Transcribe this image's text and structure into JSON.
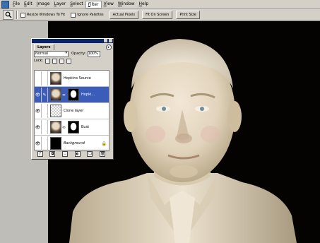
{
  "menubar": {
    "items": [
      "File",
      "Edit",
      "Image",
      "Layer",
      "Select",
      "Filter",
      "View",
      "Window",
      "Help"
    ],
    "active_index": 5
  },
  "options_bar": {
    "tool_icon": "zoom-icon",
    "resize_windows": "Resize Windows To Fit",
    "ignore_palettes": "Ignore Palettes",
    "actual_pixels": "Actual Pixels",
    "fit_on_screen": "Fit On Screen",
    "print_size": "Print Size"
  },
  "layers_palette": {
    "tab": "Layers",
    "menu_arrow": "▸",
    "blend_mode": "Normal",
    "opacity_label": "Opacity:",
    "opacity_value": "100%",
    "lock_label": "Lock:",
    "layers": [
      {
        "name": "Hopkins Source",
        "visible": false,
        "selected": false,
        "thumb": "face"
      },
      {
        "name": "Hopki...",
        "visible": true,
        "selected": true,
        "thumb": "face",
        "mask": true
      },
      {
        "name": "Clone layer",
        "visible": true,
        "selected": false,
        "thumb": "check"
      },
      {
        "name": "Bust",
        "visible": true,
        "selected": false,
        "thumb": "face",
        "mask": true
      },
      {
        "name": "Background",
        "visible": true,
        "selected": false,
        "thumb": "black",
        "locked": true
      }
    ]
  },
  "colors": {
    "canvas_bg": "#050302",
    "selection": "#3b5cb8",
    "bust": "#e6dcc8"
  }
}
